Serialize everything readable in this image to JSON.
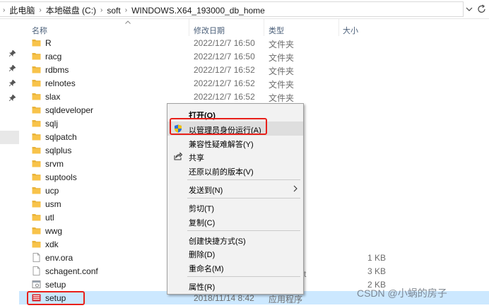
{
  "breadcrumb": {
    "items": [
      "此电脑",
      "本地磁盘 (C:)",
      "soft",
      "WINDOWS.X64_193000_db_home"
    ]
  },
  "columns": {
    "name": "名称",
    "modified": "修改日期",
    "type": "类型",
    "size": "大小"
  },
  "files": [
    {
      "name": "R",
      "date": "2022/12/7 16:50",
      "type": "文件夹",
      "size": "",
      "kind": "folder"
    },
    {
      "name": "racg",
      "date": "2022/12/7 16:50",
      "type": "文件夹",
      "size": "",
      "kind": "folder"
    },
    {
      "name": "rdbms",
      "date": "2022/12/7 16:52",
      "type": "文件夹",
      "size": "",
      "kind": "folder"
    },
    {
      "name": "relnotes",
      "date": "2022/12/7 16:52",
      "type": "文件夹",
      "size": "",
      "kind": "folder"
    },
    {
      "name": "slax",
      "date": "2022/12/7 16:52",
      "type": "文件夹",
      "size": "",
      "kind": "folder"
    },
    {
      "name": "sqldeveloper",
      "date": "",
      "type": "",
      "size": "",
      "kind": "folder"
    },
    {
      "name": "sqlj",
      "date": "",
      "type": "",
      "size": "",
      "kind": "folder"
    },
    {
      "name": "sqlpatch",
      "date": "",
      "type": "",
      "size": "",
      "kind": "folder"
    },
    {
      "name": "sqlplus",
      "date": "",
      "type": "",
      "size": "",
      "kind": "folder"
    },
    {
      "name": "srvm",
      "date": "",
      "type": "",
      "size": "",
      "kind": "folder"
    },
    {
      "name": "suptools",
      "date": "",
      "type": "",
      "size": "",
      "kind": "folder"
    },
    {
      "name": "ucp",
      "date": "",
      "type": "",
      "size": "",
      "kind": "folder"
    },
    {
      "name": "usm",
      "date": "",
      "type": "",
      "size": "",
      "kind": "folder"
    },
    {
      "name": "utl",
      "date": "",
      "type": "",
      "size": "",
      "kind": "folder"
    },
    {
      "name": "wwg",
      "date": "",
      "type": "",
      "size": "",
      "kind": "folder"
    },
    {
      "name": "xdk",
      "date": "",
      "type": "",
      "size": "",
      "kind": "folder"
    },
    {
      "name": "env.ora",
      "date": "",
      "type": "",
      "size": "1 KB",
      "kind": "file"
    },
    {
      "name": "schagent.conf",
      "date": "",
      "type": "",
      "size": "3 KB",
      "kind": "file"
    },
    {
      "name": "setup",
      "date": "",
      "type": "批处理...",
      "size": "2 KB",
      "kind": "bat"
    },
    {
      "name": "setup",
      "date": "2018/11/14 8:42",
      "type": "应用程序",
      "size": "",
      "kind": "exe"
    }
  ],
  "context_menu": {
    "items": [
      {
        "label": "打开(O)",
        "bold": true,
        "icon": ""
      },
      {
        "label": "以管理员身份运行(A)",
        "bold": false,
        "icon": "uac-shield-icon"
      },
      {
        "label": "兼容性疑难解答(Y)",
        "bold": false,
        "icon": ""
      },
      {
        "label": "共享",
        "bold": false,
        "icon": "share-icon"
      },
      {
        "label": "还原以前的版本(V)",
        "bold": false,
        "icon": ""
      },
      {
        "label": "发送到(N)",
        "bold": false,
        "icon": "",
        "submenu": true
      },
      {
        "label": "剪切(T)",
        "bold": false,
        "icon": ""
      },
      {
        "label": "复制(C)",
        "bold": false,
        "icon": ""
      },
      {
        "label": "创建快捷方式(S)",
        "bold": false,
        "icon": ""
      },
      {
        "label": "删除(D)",
        "bold": false,
        "icon": ""
      },
      {
        "label": "重命名(M)",
        "bold": false,
        "icon": ""
      },
      {
        "label": "属性(R)",
        "bold": false,
        "icon": ""
      }
    ]
  },
  "menu_partial_text": {
    "schagent_type_tail": "t",
    "setup_type_tail": "批处理..."
  },
  "watermark": "CSDN @小蜗的房子",
  "colors": {
    "selected_row": "#cce8ff",
    "menu_bg": "#f2f2f2",
    "menu_highlight": "#dedede",
    "annotation_red": "#e8201a",
    "folder_yellow": "#f8c34a"
  }
}
